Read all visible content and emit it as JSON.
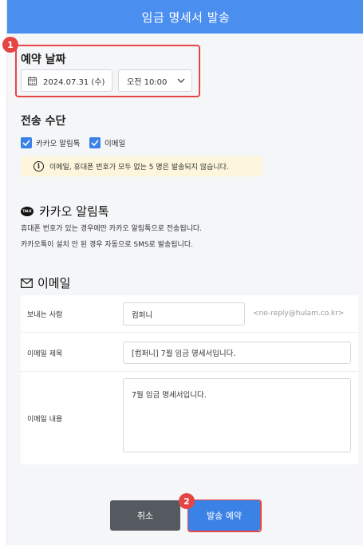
{
  "header": {
    "title": "임금 명세서 발송"
  },
  "markers": {
    "m1": "1",
    "m2": "2"
  },
  "schedule": {
    "title": "예약 날짜",
    "date": "2024.07.31 (수)",
    "time": "오전 10:00"
  },
  "method": {
    "title": "전송 수단",
    "options": [
      {
        "label": "카카오 알림톡",
        "checked": true
      },
      {
        "label": "이메일",
        "checked": true
      }
    ],
    "notice": "이메일, 휴대폰 번호가 모두 없는 5 명은 발송되지 않습니다."
  },
  "kakao": {
    "icon_label": "TALK",
    "title": "카카오 알림톡",
    "line1": "휴대폰 번호가 있는 경우에만 카카오 알림톡으로 전송됩니다.",
    "line2": "카카오톡이 설치 안 된 경우 자동으로 SMS로 발송됩니다."
  },
  "email": {
    "title": "이메일",
    "sender_label": "보내는 사람",
    "sender_value": "컴퍼니",
    "sender_hint": "<no-reply@hulam.co.kr>",
    "subject_label": "이메일 제목",
    "subject_value": "[컴퍼니] 7월 임금 명세서입니다.",
    "body_label": "이메일 내용",
    "body_value": "7월 임금 명세서입니다."
  },
  "actions": {
    "cancel_label": "취소",
    "send_label": "발송 예약"
  },
  "colors": {
    "header": "#4a8ef0",
    "accent": "#3b82e6",
    "highlight": "#e64545",
    "cancel": "#555a60",
    "notice_bg": "#fdf6dc"
  }
}
